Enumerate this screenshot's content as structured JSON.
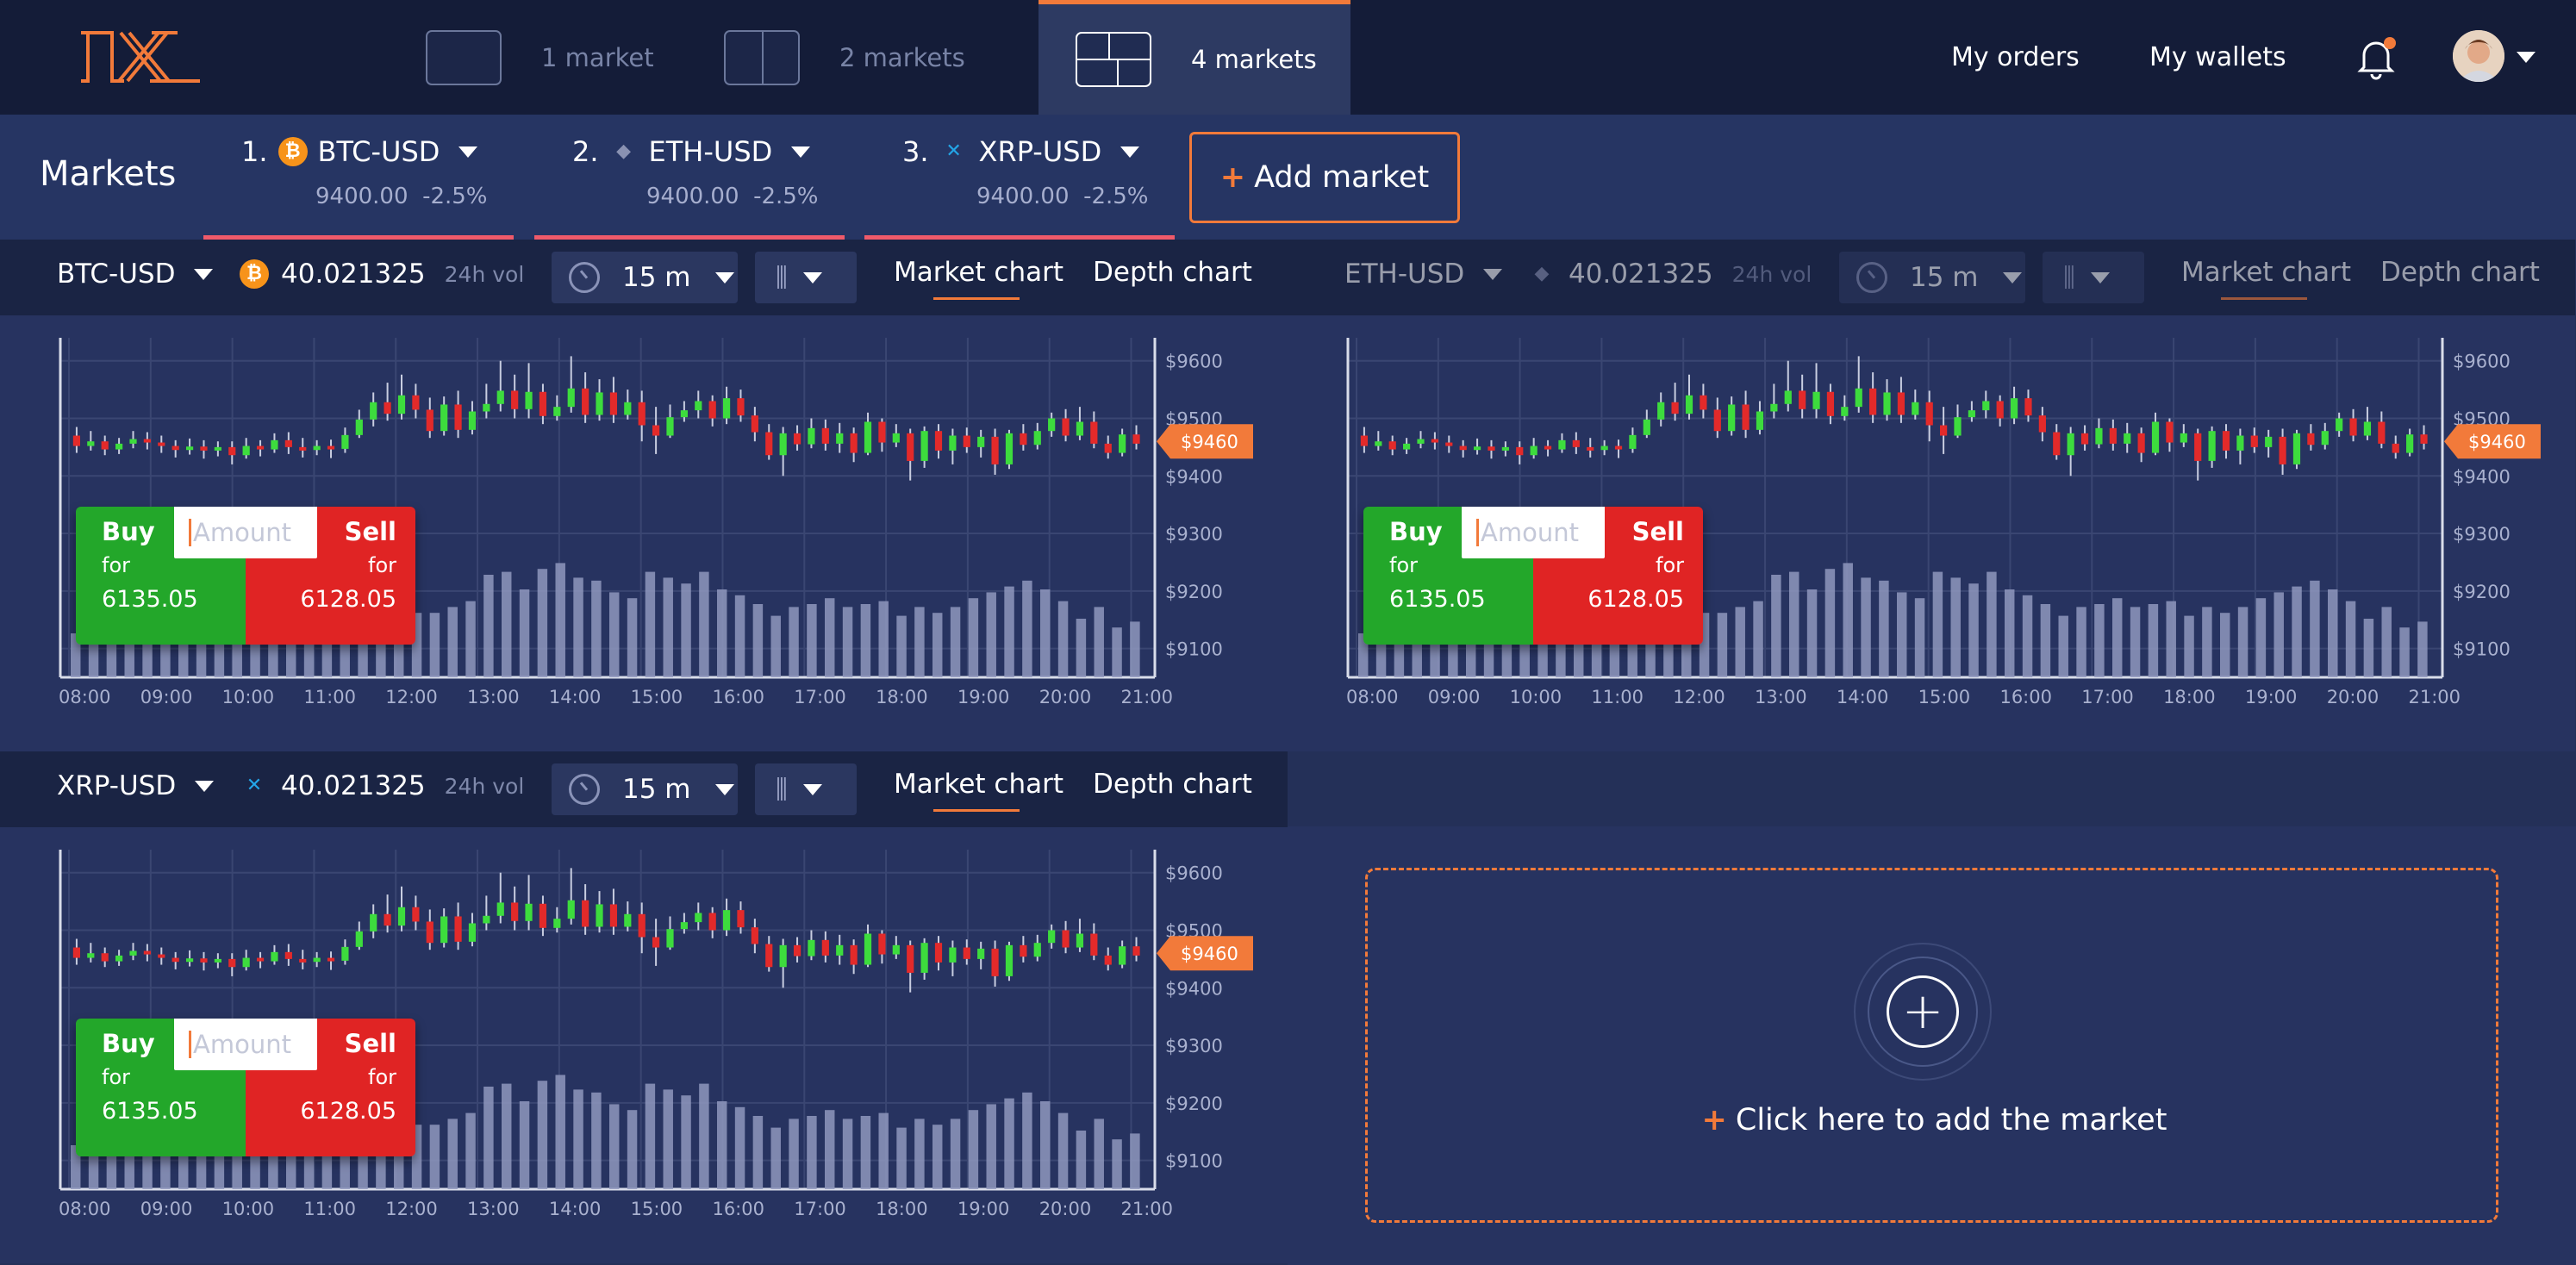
{
  "topbar": {
    "logo_text": "1X",
    "layouts": [
      {
        "label": "1 market",
        "active": false
      },
      {
        "label": "2 markets",
        "active": false
      },
      {
        "label": "4 markets",
        "active": true
      }
    ],
    "nav": {
      "orders": "My orders",
      "wallets": "My wallets"
    },
    "accent": "#f27a3a"
  },
  "markets_bar": {
    "title": "Markets",
    "tabs": [
      {
        "num": "1.",
        "pair": "BTC-USD",
        "coin": "btc-icon",
        "price": "9400.00",
        "change": "-2.5%"
      },
      {
        "num": "2.",
        "pair": "ETH-USD",
        "coin": "eth-icon",
        "price": "9400.00",
        "change": "-2.5%"
      },
      {
        "num": "3.",
        "pair": "XRP-USD",
        "coin": "xrp-icon",
        "price": "9400.00",
        "change": "-2.5%"
      }
    ],
    "add_label": "Add market"
  },
  "panels": [
    {
      "pair": "BTC-USD",
      "coin": "btc-icon",
      "volume": "40.021325",
      "vol_tag": "24h vol",
      "interval": "15 m",
      "tab_market": "Market chart",
      "tab_depth": "Depth chart",
      "trade": {
        "buy": "Buy",
        "buy_for": "for",
        "buy_price": "6135.05",
        "sell": "Sell",
        "sell_for": "for",
        "sell_price": "6128.05",
        "amount_placeholder": "Amount"
      }
    },
    {
      "pair": "ETH-USD",
      "coin": "eth-icon",
      "volume": "40.021325",
      "vol_tag": "24h vol",
      "interval": "15 m",
      "tab_market": "Market chart",
      "tab_depth": "Depth chart",
      "trade": {
        "buy": "Buy",
        "buy_for": "for",
        "buy_price": "6135.05",
        "sell": "Sell",
        "sell_for": "for",
        "sell_price": "6128.05",
        "amount_placeholder": "Amount"
      }
    },
    {
      "pair": "XRP-USD",
      "coin": "xrp-icon",
      "volume": "40.021325",
      "vol_tag": "24h vol",
      "interval": "15 m",
      "tab_market": "Market chart",
      "tab_depth": "Depth chart",
      "trade": {
        "buy": "Buy",
        "buy_for": "for",
        "buy_price": "6135.05",
        "sell": "Sell",
        "sell_for": "for",
        "sell_price": "6128.05",
        "amount_placeholder": "Amount"
      }
    }
  ],
  "add_panel": {
    "label": "Click here to add the market"
  },
  "chart_data": {
    "type": "candlestick",
    "x_ticks": [
      "08:00",
      "09:00",
      "10:00",
      "11:00",
      "12:00",
      "13:00",
      "14:00",
      "15:00",
      "16:00",
      "17:00",
      "18:00",
      "19:00",
      "20:00",
      "21:00"
    ],
    "y_ticks": [
      "$9600",
      "$9500",
      "$9400",
      "$9300",
      "$9200",
      "$9100"
    ],
    "ylim": [
      9050,
      9640
    ],
    "current_price": "$9460",
    "current_value": 9460,
    "colors": {
      "up": "#3ddc3d",
      "down": "#e32a2a",
      "volume": "#8f98bd",
      "grid": "#3a4672",
      "price_tag": "#f27a3a"
    },
    "candles": [
      [
        9470,
        9452,
        9485,
        9440
      ],
      [
        9452,
        9460,
        9478,
        9444
      ],
      [
        9460,
        9446,
        9470,
        9436
      ],
      [
        9446,
        9456,
        9466,
        9438
      ],
      [
        9456,
        9464,
        9478,
        9448
      ],
      [
        9464,
        9458,
        9476,
        9446
      ],
      [
        9458,
        9452,
        9470,
        9440
      ],
      [
        9452,
        9445,
        9462,
        9432
      ],
      [
        9445,
        9451,
        9465,
        9437
      ],
      [
        9451,
        9444,
        9462,
        9430
      ],
      [
        9444,
        9450,
        9460,
        9434
      ],
      [
        9450,
        9436,
        9460,
        9420
      ],
      [
        9436,
        9452,
        9466,
        9430
      ],
      [
        9452,
        9446,
        9462,
        9434
      ],
      [
        9446,
        9462,
        9474,
        9440
      ],
      [
        9462,
        9450,
        9476,
        9438
      ],
      [
        9450,
        9445,
        9466,
        9432
      ],
      [
        9445,
        9452,
        9462,
        9436
      ],
      [
        9452,
        9447,
        9463,
        9431
      ],
      [
        9447,
        9471,
        9484,
        9440
      ],
      [
        9471,
        9498,
        9515,
        9466
      ],
      [
        9498,
        9528,
        9545,
        9486
      ],
      [
        9528,
        9508,
        9562,
        9496
      ],
      [
        9508,
        9540,
        9576,
        9498
      ],
      [
        9540,
        9515,
        9560,
        9500
      ],
      [
        9515,
        9478,
        9536,
        9466
      ],
      [
        9478,
        9524,
        9538,
        9470
      ],
      [
        9524,
        9480,
        9548,
        9466
      ],
      [
        9480,
        9512,
        9530,
        9472
      ],
      [
        9512,
        9525,
        9560,
        9500
      ],
      [
        9525,
        9548,
        9600,
        9512
      ],
      [
        9548,
        9516,
        9576,
        9500
      ],
      [
        9516,
        9546,
        9596,
        9500
      ],
      [
        9546,
        9504,
        9560,
        9490
      ],
      [
        9504,
        9520,
        9540,
        9496
      ],
      [
        9520,
        9552,
        9608,
        9510
      ],
      [
        9552,
        9506,
        9580,
        9492
      ],
      [
        9506,
        9545,
        9568,
        9496
      ],
      [
        9545,
        9506,
        9572,
        9492
      ],
      [
        9506,
        9528,
        9550,
        9498
      ],
      [
        9528,
        9488,
        9548,
        9460
      ],
      [
        9488,
        9470,
        9520,
        9438
      ],
      [
        9470,
        9502,
        9524,
        9466
      ],
      [
        9502,
        9514,
        9530,
        9494
      ],
      [
        9514,
        9530,
        9548,
        9500
      ],
      [
        9530,
        9500,
        9540,
        9486
      ],
      [
        9500,
        9535,
        9555,
        9490
      ],
      [
        9535,
        9505,
        9550,
        9494
      ],
      [
        9505,
        9476,
        9520,
        9460
      ],
      [
        9476,
        9436,
        9490,
        9428
      ],
      [
        9436,
        9474,
        9485,
        9400
      ],
      [
        9474,
        9455,
        9488,
        9444
      ],
      [
        9455,
        9483,
        9500,
        9448
      ],
      [
        9483,
        9456,
        9498,
        9444
      ],
      [
        9456,
        9474,
        9492,
        9440
      ],
      [
        9474,
        9440,
        9484,
        9424
      ],
      [
        9440,
        9494,
        9510,
        9436
      ],
      [
        9494,
        9458,
        9500,
        9442
      ],
      [
        9458,
        9474,
        9490,
        9450
      ],
      [
        9474,
        9426,
        9482,
        9392
      ],
      [
        9426,
        9478,
        9486,
        9414
      ],
      [
        9478,
        9444,
        9490,
        9430
      ],
      [
        9444,
        9470,
        9482,
        9420
      ],
      [
        9470,
        9450,
        9484,
        9440
      ],
      [
        9450,
        9468,
        9480,
        9432
      ],
      [
        9468,
        9420,
        9482,
        9402
      ],
      [
        9420,
        9474,
        9480,
        9412
      ],
      [
        9474,
        9454,
        9490,
        9444
      ],
      [
        9454,
        9478,
        9492,
        9446
      ],
      [
        9478,
        9500,
        9510,
        9468
      ],
      [
        9500,
        9470,
        9516,
        9460
      ],
      [
        9470,
        9494,
        9520,
        9462
      ],
      [
        9494,
        9456,
        9512,
        9448
      ],
      [
        9456,
        9440,
        9470,
        9430
      ],
      [
        9440,
        9472,
        9482,
        9434
      ],
      [
        9472,
        9456,
        9488,
        9446
      ]
    ],
    "volume_bars": [
      0.3,
      0.26,
      0.34,
      0.44,
      0.45,
      0.3,
      0.4,
      0.42,
      0.34,
      0.44,
      0.38,
      0.4,
      0.32,
      0.29,
      0.46,
      0.44,
      0.3,
      0.4,
      0.32,
      0.44,
      0.44,
      0.48,
      0.52,
      0.7,
      0.72,
      0.6,
      0.74,
      0.78,
      0.68,
      0.66,
      0.58,
      0.54,
      0.72,
      0.68,
      0.64,
      0.72,
      0.6,
      0.56,
      0.5,
      0.42,
      0.48,
      0.5,
      0.54,
      0.48,
      0.5,
      0.52,
      0.42,
      0.48,
      0.44,
      0.48,
      0.54,
      0.58,
      0.62,
      0.66,
      0.6,
      0.52,
      0.4,
      0.48,
      0.34,
      0.38
    ]
  }
}
